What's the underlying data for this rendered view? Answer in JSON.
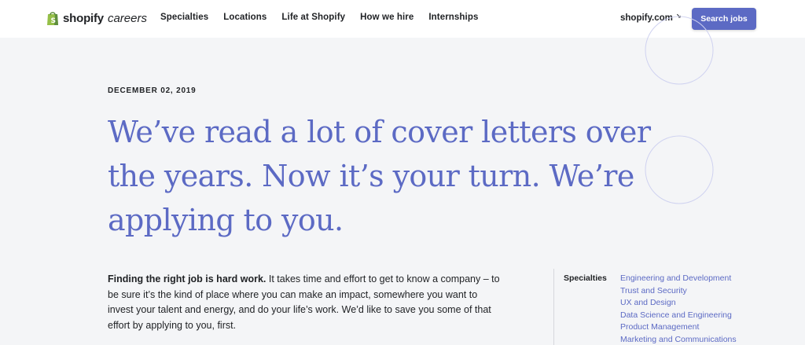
{
  "header": {
    "logo_word": "shopify",
    "logo_sub": "careers",
    "nav": [
      "Specialties",
      "Locations",
      "Life at Shopify",
      "How we hire",
      "Internships"
    ],
    "shop_link": "shopify.com",
    "search_button": "Search jobs"
  },
  "article": {
    "date": "DECEMBER 02, 2019",
    "headline": "We’ve read a lot of cover letters over the years. Now it’s your turn. We’re applying to you.",
    "intro_bold": "Finding the right job is hard work.",
    "intro_rest": " It takes time and effort to get to know a company – to be sure it’s the kind of place where you can make an impact, somewhere you want to invest your talent and energy, and do your life’s work. We’d like to save you some of that effort by applying to you, first."
  },
  "sidebar": {
    "label": "Specialties",
    "items": [
      "Engineering and Development",
      "Trust and Security",
      "UX and Design",
      "Data Science and Engineering",
      "Product Management",
      "Marketing and Communications"
    ]
  },
  "colors": {
    "accent": "#5c6ac4",
    "background": "#f4f5f7",
    "header": "#ffffff",
    "text": "#212326",
    "logo_green": "#95bf47"
  }
}
